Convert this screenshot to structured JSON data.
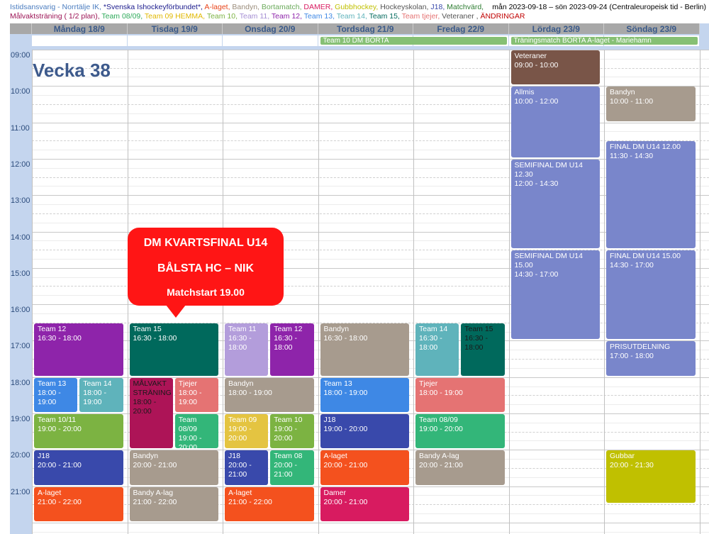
{
  "legend": {
    "line1": [
      {
        "text": "Istidsansvarig - Norrtälje IK, ",
        "color": "#4a7cbf"
      },
      {
        "text": "*Svenska Ishockeyförbundet*, ",
        "color": "#1a1a8c"
      },
      {
        "text": "A-laget, ",
        "color": "#e8441a"
      },
      {
        "text": "Bandyn, ",
        "color": "#9a8c7a"
      },
      {
        "text": "Bortamatch, ",
        "color": "#6aaa5a"
      },
      {
        "text": "DAMER, ",
        "color": "#d81b60"
      },
      {
        "text": "Gubbhockey, ",
        "color": "#c0c000"
      },
      {
        "text": "Hockeyskolan, ",
        "color": "#555555"
      },
      {
        "text": "J18, ",
        "color": "#3949ab"
      },
      {
        "text": "Matchvärd, ",
        "color": "#2e7d32"
      }
    ],
    "line2": [
      {
        "text": "Målvaktsträning ( 1/2 plan), ",
        "color": "#9c1455"
      },
      {
        "text": "Team 08/09, ",
        "color": "#2eaa5a"
      },
      {
        "text": "Team 09 HEMMA, ",
        "color": "#e0b800"
      },
      {
        "text": "Team 10, ",
        "color": "#7cb342"
      },
      {
        "text": "Team 11, ",
        "color": "#a58fd4"
      },
      {
        "text": "Team 12, ",
        "color": "#8e24aa"
      },
      {
        "text": "Team 13, ",
        "color": "#3e88e5"
      },
      {
        "text": "Team 14, ",
        "color": "#5fb3bb"
      },
      {
        "text": "Team 15, ",
        "color": "#00695c"
      },
      {
        "text": "Team tjejer, ",
        "color": "#e57373"
      },
      {
        "text": "Veteraner , ",
        "color": "#555555"
      },
      {
        "text": "ÄNDRINGAR",
        "color": "#c00000"
      }
    ]
  },
  "date_range": "mån 2023-09-18 – sön 2023-09-24 (Centraleuropeisk tid - Berlin)",
  "week_label": "Vecka 38",
  "days": [
    "Måndag 18/9",
    "Tisdag 19/9",
    "Onsdag 20/9",
    "Tordsdag 21/9",
    "Fredag 22/9",
    "Lördag 23/9",
    "Söndag 23/9"
  ],
  "allday_events": [
    {
      "day": 3,
      "span": 2,
      "title": "Team 10 DM BORTA"
    },
    {
      "day": 5,
      "span": 2,
      "title": "Träningsmatch BORTA A-laget - Mariehamn"
    }
  ],
  "times": [
    "09:00",
    "10:00",
    "11:00",
    "12:00",
    "13:00",
    "14:00",
    "15:00",
    "16:00",
    "17:00",
    "18:00",
    "19:00",
    "20:00",
    "21:00"
  ],
  "events": [
    {
      "day": 0,
      "lane": 0,
      "lanes": 1,
      "start": 16.5,
      "end": 18,
      "title": "Team 12",
      "time": "16:30 - 18:00",
      "color": "#8e24aa"
    },
    {
      "day": 0,
      "lane": 0,
      "lanes": 2,
      "start": 18,
      "end": 19,
      "title": "Team 13",
      "time": "18:00 - 19:00",
      "color": "#3e88e5"
    },
    {
      "day": 0,
      "lane": 1,
      "lanes": 2,
      "start": 18,
      "end": 19,
      "title": "Team 14",
      "time": "18:00 - 19:00",
      "color": "#5fb3bb"
    },
    {
      "day": 0,
      "lane": 0,
      "lanes": 1,
      "start": 19,
      "end": 20,
      "title": "Team 10/11",
      "time": "19:00 - 20:00",
      "color": "#7cb342"
    },
    {
      "day": 0,
      "lane": 0,
      "lanes": 1,
      "start": 20,
      "end": 21,
      "title": "J18",
      "time": "20:00 - 21:00",
      "color": "#3949ab"
    },
    {
      "day": 0,
      "lane": 0,
      "lanes": 1,
      "start": 21,
      "end": 22,
      "title": "A-laget",
      "time": "21:00 - 22:00",
      "color": "#f4511e"
    },
    {
      "day": 1,
      "lane": 0,
      "lanes": 1,
      "start": 16.5,
      "end": 18,
      "title": "Team 15",
      "time": "16:30 - 18:00",
      "color": "#00695c"
    },
    {
      "day": 1,
      "lane": 0,
      "lanes": 2,
      "start": 18,
      "end": 20,
      "title": "MÅLVAKT STRÄNING",
      "time": "18:00 - 20:00",
      "color": "#ad1457",
      "tcolor": "#1a1a1a"
    },
    {
      "day": 1,
      "lane": 1,
      "lanes": 2,
      "start": 18,
      "end": 19,
      "title": "Tjejer",
      "time": "18:00 - 19:00",
      "color": "#e57373"
    },
    {
      "day": 1,
      "lane": 1,
      "lanes": 2,
      "start": 19,
      "end": 20,
      "title": "Team 08/09",
      "time": "19:00 - 20:00",
      "color": "#33b679"
    },
    {
      "day": 1,
      "lane": 0,
      "lanes": 1,
      "start": 20,
      "end": 21,
      "title": "Bandyn",
      "time": "20:00 - 21:00",
      "color": "#a79b8e"
    },
    {
      "day": 1,
      "lane": 0,
      "lanes": 1,
      "start": 21,
      "end": 22,
      "title": "Bandy A-lag",
      "time": "21:00 - 22:00",
      "color": "#a79b8e"
    },
    {
      "day": 2,
      "lane": 0,
      "lanes": 2,
      "start": 16.5,
      "end": 18,
      "title": "Team 11",
      "time": "16:30 - 18:00",
      "color": "#b39ddb"
    },
    {
      "day": 2,
      "lane": 1,
      "lanes": 2,
      "start": 16.5,
      "end": 18,
      "title": "Team 12",
      "time": "16:30 - 18:00",
      "color": "#8e24aa"
    },
    {
      "day": 2,
      "lane": 0,
      "lanes": 1,
      "start": 18,
      "end": 19,
      "title": "Bandyn",
      "time": "18:00 - 19:00",
      "color": "#a79b8e"
    },
    {
      "day": 2,
      "lane": 0,
      "lanes": 2,
      "start": 19,
      "end": 20,
      "title": "Team 09",
      "time": "19:00 - 20:00",
      "color": "#e4c441"
    },
    {
      "day": 2,
      "lane": 1,
      "lanes": 2,
      "start": 19,
      "end": 20,
      "title": "Team 10",
      "time": "19:00 - 20:00",
      "color": "#7cb342"
    },
    {
      "day": 2,
      "lane": 0,
      "lanes": 2,
      "start": 20,
      "end": 21,
      "title": "J18",
      "time": "20:00 - 21:00",
      "color": "#3949ab"
    },
    {
      "day": 2,
      "lane": 1,
      "lanes": 2,
      "start": 20,
      "end": 21,
      "title": "Team 08",
      "time": "20:00 - 21:00",
      "color": "#33b679"
    },
    {
      "day": 2,
      "lane": 0,
      "lanes": 1,
      "start": 21,
      "end": 22,
      "title": "A-laget",
      "time": "21:00 - 22:00",
      "color": "#f4511e"
    },
    {
      "day": 3,
      "lane": 0,
      "lanes": 1,
      "start": 16.5,
      "end": 18,
      "title": "Bandyn",
      "time": "16:30 - 18:00",
      "color": "#a79b8e"
    },
    {
      "day": 3,
      "lane": 0,
      "lanes": 1,
      "start": 18,
      "end": 19,
      "title": "Team 13",
      "time": "18:00 - 19:00",
      "color": "#3e88e5"
    },
    {
      "day": 3,
      "lane": 0,
      "lanes": 1,
      "start": 19,
      "end": 20,
      "title": "J18",
      "time": "19:00 - 20:00",
      "color": "#3949ab"
    },
    {
      "day": 3,
      "lane": 0,
      "lanes": 1,
      "start": 20,
      "end": 21,
      "title": "A-laget",
      "time": "20:00 - 21:00",
      "color": "#f4511e"
    },
    {
      "day": 3,
      "lane": 0,
      "lanes": 1,
      "start": 21,
      "end": 22,
      "title": "Damer",
      "time": "20:00 - 21:00",
      "color": "#d81b60"
    },
    {
      "day": 4,
      "lane": 0,
      "lanes": 2,
      "start": 16.5,
      "end": 18,
      "title": "Team 14",
      "time": "16:30 - 18:00",
      "color": "#5fb3bb"
    },
    {
      "day": 4,
      "lane": 1,
      "lanes": 2,
      "start": 16.5,
      "end": 18,
      "title": "Team 15",
      "time": "16:30 - 18:00",
      "color": "#00695c",
      "tcolor": "#1a1a1a"
    },
    {
      "day": 4,
      "lane": 0,
      "lanes": 1,
      "start": 18,
      "end": 19,
      "title": "Tjejer",
      "time": "18:00 - 19:00",
      "color": "#e57373"
    },
    {
      "day": 4,
      "lane": 0,
      "lanes": 1,
      "start": 19,
      "end": 20,
      "title": "Team 08/09",
      "time": "19:00 - 20:00",
      "color": "#33b679"
    },
    {
      "day": 4,
      "lane": 0,
      "lanes": 1,
      "start": 20,
      "end": 21,
      "title": "Bandy A-lag",
      "time": "20:00 - 21:00",
      "color": "#a79b8e"
    },
    {
      "day": 5,
      "lane": 0,
      "lanes": 1,
      "start": 9,
      "end": 10,
      "title": "Veteraner",
      "time": "09:00 - 10:00",
      "color": "#795548"
    },
    {
      "day": 5,
      "lane": 0,
      "lanes": 1,
      "start": 10,
      "end": 12,
      "title": "Allmis",
      "time": "10:00 - 12:00",
      "color": "#7986cb"
    },
    {
      "day": 5,
      "lane": 0,
      "lanes": 1,
      "start": 12,
      "end": 14.5,
      "title": "SEMIFINAL DM U14 12.30",
      "time": "12:00 - 14:30",
      "color": "#7986cb"
    },
    {
      "day": 5,
      "lane": 0,
      "lanes": 1,
      "start": 14.5,
      "end": 17,
      "title": "SEMIFINAL DM U14 15.00",
      "time": "14:30 - 17:00",
      "color": "#7986cb"
    },
    {
      "day": 6,
      "lane": 0,
      "lanes": 1,
      "start": 10,
      "end": 11,
      "title": "Bandyn",
      "time": "10:00 - 11:00",
      "color": "#a79b8e"
    },
    {
      "day": 6,
      "lane": 0,
      "lanes": 1,
      "start": 11.5,
      "end": 14.5,
      "title": "FINAL DM U14 12.00",
      "time": "11:30 - 14:30",
      "color": "#7986cb"
    },
    {
      "day": 6,
      "lane": 0,
      "lanes": 1,
      "start": 14.5,
      "end": 17,
      "title": "FINAL DM U14 15.00",
      "time": "14:30 - 17:00",
      "color": "#7986cb"
    },
    {
      "day": 6,
      "lane": 0,
      "lanes": 1,
      "start": 17,
      "end": 18,
      "title": "PRISUTDELNING",
      "time": "17:00 - 18:00",
      "color": "#7986cb"
    },
    {
      "day": 6,
      "lane": 0,
      "lanes": 1,
      "start": 20,
      "end": 21.5,
      "title": "Gubbar",
      "time": "20:00 - 21:30",
      "color": "#c0c000"
    }
  ],
  "callout": {
    "line1": "DM KVARTSFINAL U14",
    "line2": "BÅLSTA HC – NIK",
    "line3": "Matchstart 19.00"
  }
}
